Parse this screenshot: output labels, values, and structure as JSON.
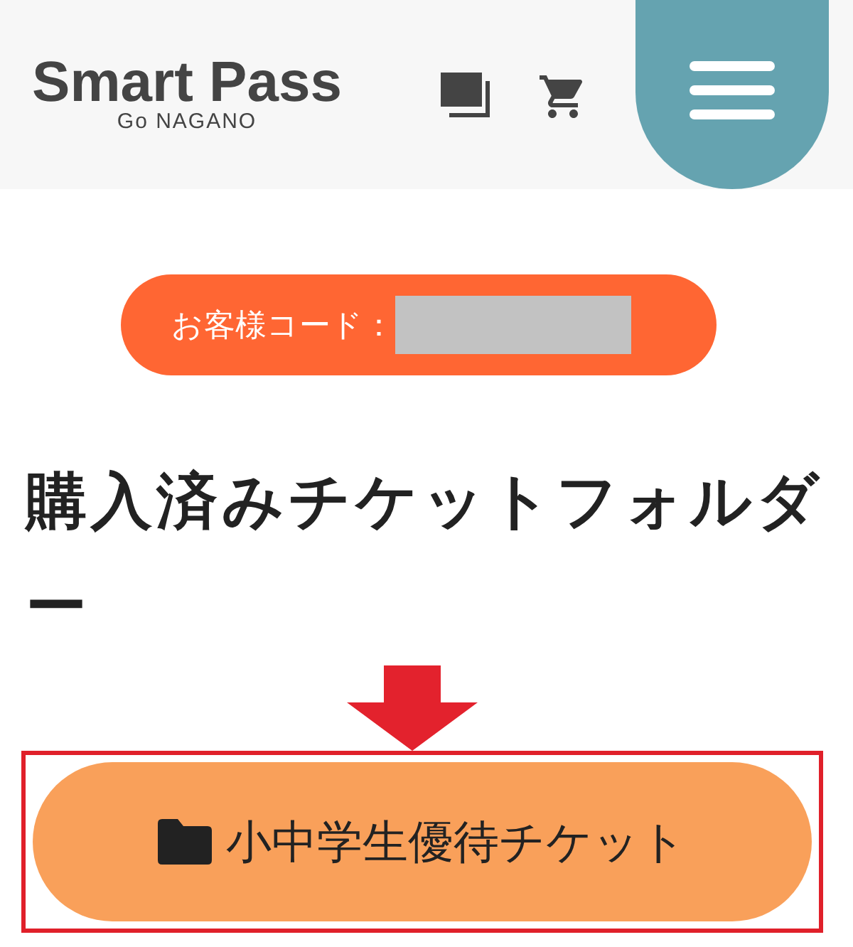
{
  "header": {
    "logo": "Smart Pass",
    "logo_sub": "Go NAGANO"
  },
  "customer_code": {
    "label": "お客様コード："
  },
  "heading": "購入済みチケットフォルダー",
  "folders": [
    {
      "label": "小中学生優待チケット",
      "highlighted": true
    }
  ]
}
